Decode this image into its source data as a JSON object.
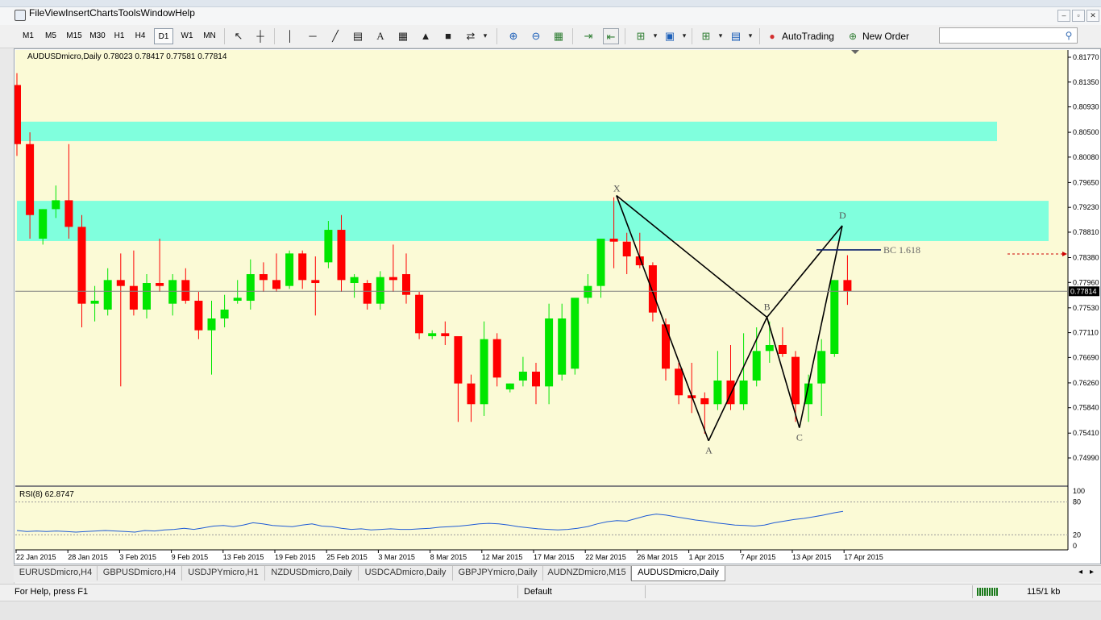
{
  "menu": [
    "File",
    "View",
    "Insert",
    "Charts",
    "Tools",
    "Window",
    "Help"
  ],
  "window_buttons": [
    "–",
    "▫",
    "✕"
  ],
  "timeframes": [
    "M1",
    "M5",
    "M15",
    "M30",
    "H1",
    "H4",
    "D1",
    "W1",
    "MN"
  ],
  "active_timeframe": "D1",
  "toolbar": {
    "autotrading_label": "AutoTrading",
    "new_order_label": "New Order",
    "search_value": ""
  },
  "chart": {
    "header": "AUDUSDmicro,Daily  0.78023 0.78417 0.77581 0.77814",
    "current_price_label": "0.77814",
    "indicator_label": "RSI(8) 62.8747",
    "pattern_labels": {
      "X": "X",
      "A": "A",
      "B": "B",
      "C": "C",
      "D": "D"
    },
    "bc_label": "BC 1.618",
    "colors": {
      "bg": "#fbfad6",
      "bull": "#00e600",
      "bear": "#ff0000",
      "zone": "#80ffdd",
      "rsi": "#1e5bd6"
    }
  },
  "chart_data": {
    "type": "candlestick",
    "price_axis_ticks": [
      "0.81770",
      "0.81350",
      "0.80930",
      "0.80500",
      "0.80080",
      "0.79650",
      "0.79230",
      "0.78810",
      "0.78380",
      "0.77960",
      "0.77530",
      "0.77110",
      "0.76690",
      "0.76260",
      "0.75840",
      "0.75410",
      "0.74990"
    ],
    "rsi_axis_ticks": [
      "100",
      "80",
      "20",
      "0"
    ],
    "date_labels": [
      "22 Jan 2015",
      "28 Jan 2015",
      "3 Feb 2015",
      "9 Feb 2015",
      "13 Feb 2015",
      "19 Feb 2015",
      "25 Feb 2015",
      "3 Mar 2015",
      "8 Mar 2015",
      "12 Mar 2015",
      "17 Mar 2015",
      "22 Mar 2015",
      "26 Mar 2015",
      "1 Apr 2015",
      "7 Apr 2015",
      "13 Apr 2015",
      "17 Apr 2015"
    ],
    "resistance_zones": [
      [
        0.8035,
        0.8068
      ],
      [
        0.7866,
        0.7934
      ]
    ],
    "pattern_points": {
      "X": 0.7943,
      "A": 0.7528,
      "B": 0.7737,
      "C": 0.755,
      "D": 0.7892
    },
    "bc_level": 0.7851,
    "candles": [
      {
        "o": 0.813,
        "h": 0.815,
        "l": 0.801,
        "c": 0.803
      },
      {
        "o": 0.803,
        "h": 0.805,
        "l": 0.787,
        "c": 0.791
      },
      {
        "o": 0.787,
        "h": 0.792,
        "l": 0.786,
        "c": 0.792
      },
      {
        "o": 0.792,
        "h": 0.796,
        "l": 0.7905,
        "c": 0.7935
      },
      {
        "o": 0.7935,
        "h": 0.803,
        "l": 0.787,
        "c": 0.789
      },
      {
        "o": 0.789,
        "h": 0.791,
        "l": 0.772,
        "c": 0.776
      },
      {
        "o": 0.776,
        "h": 0.779,
        "l": 0.773,
        "c": 0.7765
      },
      {
        "o": 0.775,
        "h": 0.782,
        "l": 0.774,
        "c": 0.78
      },
      {
        "o": 0.78,
        "h": 0.7845,
        "l": 0.762,
        "c": 0.779
      },
      {
        "o": 0.779,
        "h": 0.785,
        "l": 0.774,
        "c": 0.775
      },
      {
        "o": 0.775,
        "h": 0.781,
        "l": 0.7735,
        "c": 0.7795
      },
      {
        "o": 0.7795,
        "h": 0.787,
        "l": 0.778,
        "c": 0.779
      },
      {
        "o": 0.776,
        "h": 0.781,
        "l": 0.774,
        "c": 0.78
      },
      {
        "o": 0.78,
        "h": 0.782,
        "l": 0.776,
        "c": 0.7765
      },
      {
        "o": 0.7765,
        "h": 0.778,
        "l": 0.77,
        "c": 0.7715
      },
      {
        "o": 0.7715,
        "h": 0.7765,
        "l": 0.764,
        "c": 0.7735
      },
      {
        "o": 0.7735,
        "h": 0.7775,
        "l": 0.772,
        "c": 0.775
      },
      {
        "o": 0.7765,
        "h": 0.78,
        "l": 0.776,
        "c": 0.777
      },
      {
        "o": 0.7765,
        "h": 0.7835,
        "l": 0.775,
        "c": 0.781
      },
      {
        "o": 0.781,
        "h": 0.783,
        "l": 0.778,
        "c": 0.78
      },
      {
        "o": 0.78,
        "h": 0.7845,
        "l": 0.778,
        "c": 0.7785
      },
      {
        "o": 0.779,
        "h": 0.785,
        "l": 0.7785,
        "c": 0.7845
      },
      {
        "o": 0.7845,
        "h": 0.785,
        "l": 0.7785,
        "c": 0.78
      },
      {
        "o": 0.78,
        "h": 0.784,
        "l": 0.774,
        "c": 0.7795
      },
      {
        "o": 0.783,
        "h": 0.79,
        "l": 0.782,
        "c": 0.7885
      },
      {
        "o": 0.7885,
        "h": 0.791,
        "l": 0.778,
        "c": 0.78
      },
      {
        "o": 0.7795,
        "h": 0.781,
        "l": 0.777,
        "c": 0.7805
      },
      {
        "o": 0.7795,
        "h": 0.78,
        "l": 0.775,
        "c": 0.776
      },
      {
        "o": 0.776,
        "h": 0.7815,
        "l": 0.775,
        "c": 0.7805
      },
      {
        "o": 0.7805,
        "h": 0.786,
        "l": 0.778,
        "c": 0.78
      },
      {
        "o": 0.781,
        "h": 0.7845,
        "l": 0.776,
        "c": 0.7775
      },
      {
        "o": 0.7775,
        "h": 0.778,
        "l": 0.77,
        "c": 0.771
      },
      {
        "o": 0.7705,
        "h": 0.7715,
        "l": 0.77,
        "c": 0.771
      },
      {
        "o": 0.771,
        "h": 0.773,
        "l": 0.769,
        "c": 0.7705
      },
      {
        "o": 0.7705,
        "h": 0.7705,
        "l": 0.756,
        "c": 0.7625
      },
      {
        "o": 0.7625,
        "h": 0.764,
        "l": 0.756,
        "c": 0.759
      },
      {
        "o": 0.759,
        "h": 0.773,
        "l": 0.757,
        "c": 0.77
      },
      {
        "o": 0.77,
        "h": 0.771,
        "l": 0.762,
        "c": 0.7635
      },
      {
        "o": 0.7615,
        "h": 0.7625,
        "l": 0.761,
        "c": 0.7625
      },
      {
        "o": 0.763,
        "h": 0.767,
        "l": 0.762,
        "c": 0.7645
      },
      {
        "o": 0.7645,
        "h": 0.766,
        "l": 0.759,
        "c": 0.762
      },
      {
        "o": 0.762,
        "h": 0.776,
        "l": 0.759,
        "c": 0.7735
      },
      {
        "o": 0.764,
        "h": 0.776,
        "l": 0.763,
        "c": 0.7735
      },
      {
        "o": 0.765,
        "h": 0.775,
        "l": 0.764,
        "c": 0.777
      },
      {
        "o": 0.777,
        "h": 0.781,
        "l": 0.776,
        "c": 0.779
      },
      {
        "o": 0.779,
        "h": 0.786,
        "l": 0.777,
        "c": 0.787
      },
      {
        "o": 0.787,
        "h": 0.794,
        "l": 0.782,
        "c": 0.7865
      },
      {
        "o": 0.7865,
        "h": 0.788,
        "l": 0.781,
        "c": 0.784
      },
      {
        "o": 0.784,
        "h": 0.788,
        "l": 0.782,
        "c": 0.7825
      },
      {
        "o": 0.7825,
        "h": 0.783,
        "l": 0.773,
        "c": 0.7745
      },
      {
        "o": 0.7725,
        "h": 0.7735,
        "l": 0.763,
        "c": 0.765
      },
      {
        "o": 0.765,
        "h": 0.766,
        "l": 0.759,
        "c": 0.7605
      },
      {
        "o": 0.7605,
        "h": 0.766,
        "l": 0.7575,
        "c": 0.76
      },
      {
        "o": 0.76,
        "h": 0.761,
        "l": 0.754,
        "c": 0.759
      },
      {
        "o": 0.759,
        "h": 0.768,
        "l": 0.758,
        "c": 0.763
      },
      {
        "o": 0.763,
        "h": 0.769,
        "l": 0.758,
        "c": 0.759
      },
      {
        "o": 0.759,
        "h": 0.771,
        "l": 0.758,
        "c": 0.763
      },
      {
        "o": 0.763,
        "h": 0.772,
        "l": 0.762,
        "c": 0.768
      },
      {
        "o": 0.768,
        "h": 0.773,
        "l": 0.766,
        "c": 0.769
      },
      {
        "o": 0.769,
        "h": 0.772,
        "l": 0.767,
        "c": 0.7675
      },
      {
        "o": 0.767,
        "h": 0.768,
        "l": 0.756,
        "c": 0.759
      },
      {
        "o": 0.759,
        "h": 0.764,
        "l": 0.756,
        "c": 0.7625
      },
      {
        "o": 0.7625,
        "h": 0.77,
        "l": 0.757,
        "c": 0.768
      },
      {
        "o": 0.7675,
        "h": 0.78,
        "l": 0.767,
        "c": 0.78
      },
      {
        "o": 0.78,
        "h": 0.7842,
        "l": 0.7758,
        "c": 0.7781
      }
    ],
    "rsi_values": [
      28,
      26,
      27,
      26,
      27,
      26,
      25,
      26,
      27,
      28,
      27,
      26,
      25,
      28,
      27,
      29,
      30,
      32,
      30,
      33,
      36,
      37,
      35,
      38,
      42,
      40,
      37,
      36,
      35,
      38,
      40,
      36,
      35,
      32,
      30,
      31,
      29,
      30,
      31,
      30,
      30,
      31,
      32,
      34,
      35,
      36,
      38,
      40,
      41,
      40,
      38,
      35,
      33,
      31,
      30,
      29,
      30,
      32,
      35,
      40,
      44,
      46,
      45,
      50,
      55,
      58,
      56,
      53,
      50,
      47,
      45,
      42,
      40,
      38,
      37,
      36,
      38,
      42,
      45,
      48,
      50,
      53,
      56,
      60,
      63
    ]
  },
  "tabs": [
    "EURUSDmicro,H4",
    "GBPUSDmicro,H4",
    "USDJPYmicro,H1",
    "NZDUSDmicro,Daily",
    "USDCADmicro,Daily",
    "GBPJPYmicro,Daily",
    "AUDNZDmicro,M15",
    "AUDUSDmicro,Daily"
  ],
  "active_tab": "AUDUSDmicro,Daily",
  "status": {
    "help": "For Help, press F1",
    "profile": "Default",
    "traffic": "115/1 kb"
  }
}
